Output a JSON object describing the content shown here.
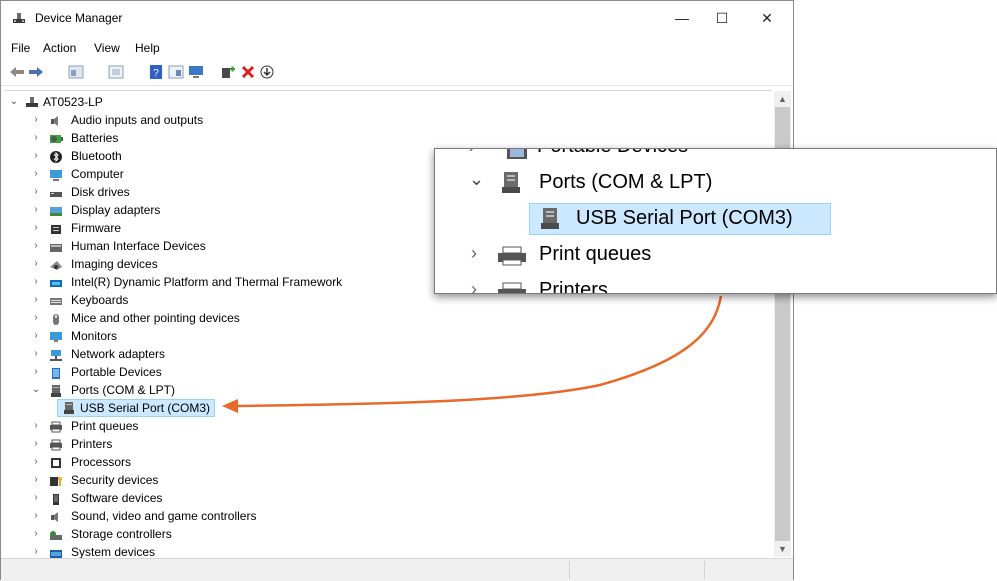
{
  "window": {
    "title": "Device Manager",
    "controls": {
      "minimize": "—",
      "maximize": "☐",
      "close": "✕"
    }
  },
  "menu": [
    "File",
    "Action",
    "View",
    "Help"
  ],
  "tree": {
    "root": "AT0523-LP",
    "items": [
      {
        "label": "Audio inputs and outputs",
        "icon": "speaker-icon",
        "expanded": false
      },
      {
        "label": "Batteries",
        "icon": "battery-icon",
        "expanded": false
      },
      {
        "label": "Bluetooth",
        "icon": "bluetooth-icon",
        "expanded": false
      },
      {
        "label": "Computer",
        "icon": "computer-icon",
        "expanded": false
      },
      {
        "label": "Disk drives",
        "icon": "disk-drive-icon",
        "expanded": false
      },
      {
        "label": "Display adapters",
        "icon": "display-adapter-icon",
        "expanded": false
      },
      {
        "label": "Firmware",
        "icon": "firmware-icon",
        "expanded": false
      },
      {
        "label": "Human Interface Devices",
        "icon": "hid-icon",
        "expanded": false
      },
      {
        "label": "Imaging devices",
        "icon": "camera-icon",
        "expanded": false
      },
      {
        "label": "Intel(R) Dynamic Platform and Thermal Framework",
        "icon": "intel-icon",
        "expanded": false
      },
      {
        "label": "Keyboards",
        "icon": "keyboard-icon",
        "expanded": false
      },
      {
        "label": "Mice and other pointing devices",
        "icon": "mouse-icon",
        "expanded": false
      },
      {
        "label": "Monitors",
        "icon": "monitor-icon",
        "expanded": false
      },
      {
        "label": "Network adapters",
        "icon": "network-icon",
        "expanded": false
      },
      {
        "label": "Portable Devices",
        "icon": "portable-device-icon",
        "expanded": false
      },
      {
        "label": "Ports (COM & LPT)",
        "icon": "port-icon",
        "expanded": true
      },
      {
        "label": "USB Serial Port (COM3)",
        "icon": "port-icon",
        "child": true,
        "selected": true
      },
      {
        "label": "Print queues",
        "icon": "printer-icon",
        "expanded": false
      },
      {
        "label": "Printers",
        "icon": "printer-icon",
        "expanded": false
      },
      {
        "label": "Processors",
        "icon": "processor-icon",
        "expanded": false
      },
      {
        "label": "Security devices",
        "icon": "security-icon",
        "expanded": false
      },
      {
        "label": "Software devices",
        "icon": "software-icon",
        "expanded": false
      },
      {
        "label": "Sound, video and game controllers",
        "icon": "speaker-icon",
        "expanded": false
      },
      {
        "label": "Storage controllers",
        "icon": "storage-icon",
        "expanded": false
      },
      {
        "label": "System devices",
        "icon": "system-icon",
        "expanded": false
      }
    ]
  },
  "zoom": {
    "top_partial": "Portable Devices",
    "expanded": "Ports (COM & LPT)",
    "selected": "USB Serial Port (COM3)",
    "next": "Print queues",
    "bottom_partial": "Printers"
  },
  "colors": {
    "selection": "#cce8ff",
    "arrow": "#e8692a"
  }
}
